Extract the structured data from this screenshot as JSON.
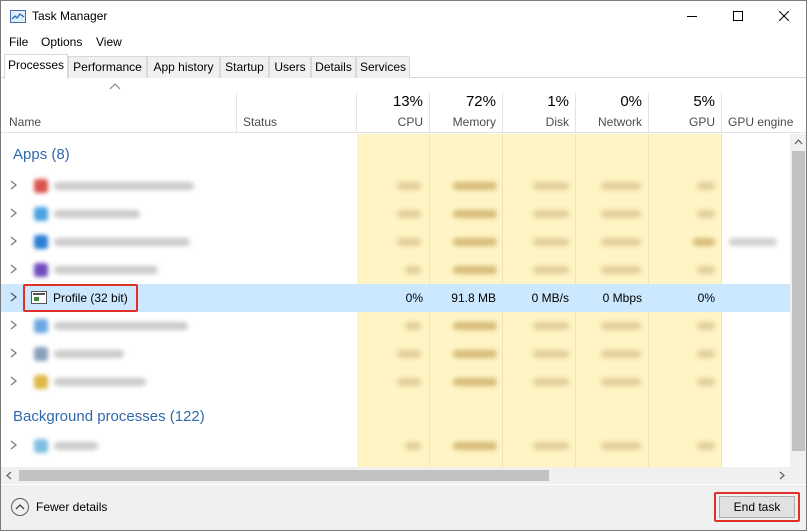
{
  "window": {
    "title": "Task Manager"
  },
  "menu": [
    "File",
    "Options",
    "View"
  ],
  "tabs": [
    "Processes",
    "Performance",
    "App history",
    "Startup",
    "Users",
    "Details",
    "Services"
  ],
  "active_tab": "Processes",
  "columns": {
    "name": "Name",
    "status": "Status",
    "cpu": {
      "pct": "13%",
      "label": "CPU"
    },
    "memory": {
      "pct": "72%",
      "label": "Memory"
    },
    "disk": {
      "pct": "1%",
      "label": "Disk"
    },
    "network": {
      "pct": "0%",
      "label": "Network"
    },
    "gpu": {
      "pct": "5%",
      "label": "GPU"
    },
    "gpu_engine": "GPU engine"
  },
  "groups": {
    "apps": "Apps (8)",
    "background": "Background processes (122)"
  },
  "selected_row": {
    "name": "Profile (32 bit)",
    "cpu": "0%",
    "memory": "91.8 MB",
    "disk": "0 MB/s",
    "network": "0 Mbps",
    "gpu": "0%"
  },
  "footer": {
    "fewer_details": "Fewer details",
    "end_task": "End task"
  },
  "colors": {
    "group_title": "#2f6aaa",
    "selected_row": "#cce8ff",
    "highlight": "#e0302a",
    "metric_bg": "#fff4c4"
  },
  "icons": [
    "task-manager-icon",
    "minimize-icon",
    "maximize-icon",
    "close-icon",
    "sort-up-icon",
    "chevron-right-icon",
    "chevron-up-icon"
  ]
}
